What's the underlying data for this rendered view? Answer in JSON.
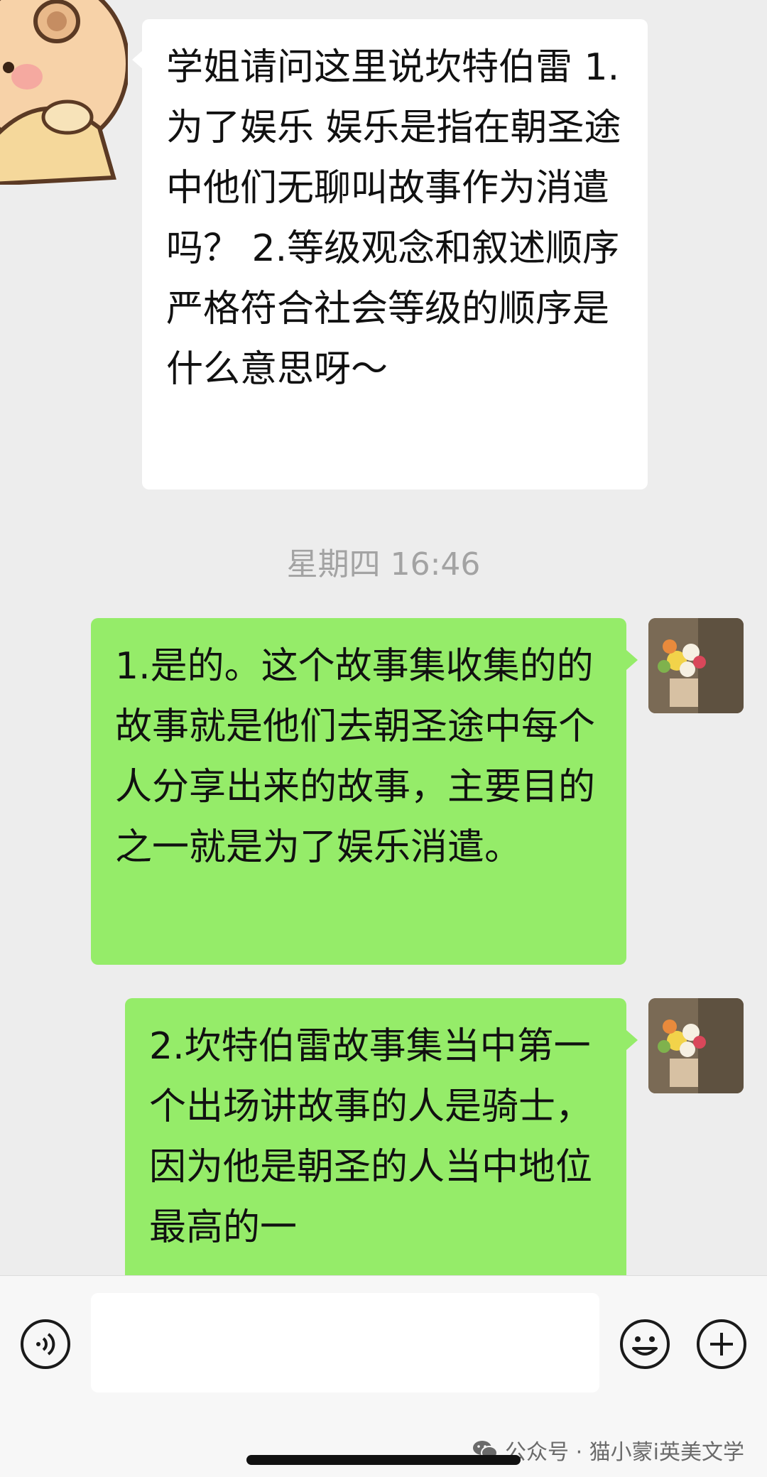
{
  "chat": {
    "messages": [
      {
        "direction": "incoming",
        "text": "学姐请问这里说坎特伯雷 1.为了娱乐 娱乐是指在朝圣途中他们无聊叫故事作为消遣吗？ 2.等级观念和叙述顺序严格符合社会等级的顺序是什么意思呀～"
      },
      {
        "direction": "outgoing",
        "text": "1.是的。这个故事集收集的的故事就是他们去朝圣途中每个人分享出来的故事，主要目的之一就是为了娱乐消遣。"
      },
      {
        "direction": "outgoing",
        "text": "2.坎特伯雷故事集当中第一个出场讲故事的人是骑士，因为他是朝圣的人当中地位最高的一"
      }
    ],
    "timestamp": "星期四 16:46"
  },
  "input_bar": {
    "placeholder": "",
    "icons": [
      "voice-icon",
      "emoji-icon",
      "plus-icon"
    ]
  },
  "watermark": {
    "text": "公众号 · 猫小蒙i英美文学",
    "icon": "wechat-icon"
  },
  "colors": {
    "background": "#ededed",
    "incoming_bubble": "#ffffff",
    "outgoing_bubble": "#95ec69",
    "timestamp": "#a3a3a3"
  }
}
